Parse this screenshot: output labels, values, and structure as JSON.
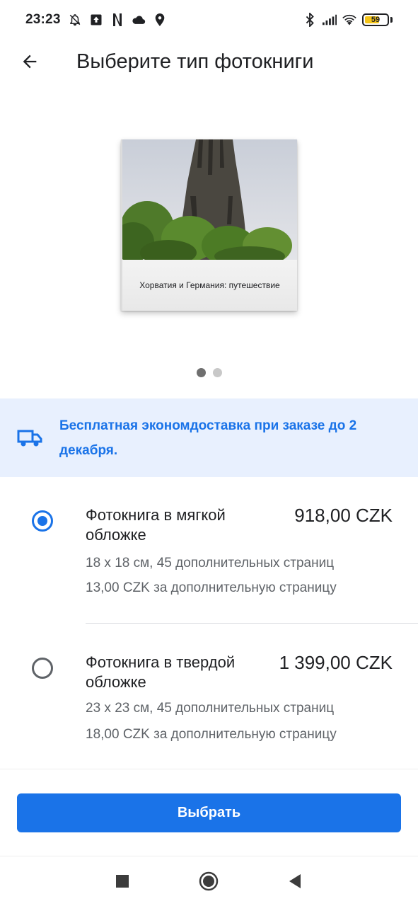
{
  "status_bar": {
    "time": "23:23",
    "battery": "59",
    "left_icons": [
      "bell-off-icon",
      "upload-icon",
      "netflix-icon",
      "cloud-icon",
      "location-icon"
    ],
    "right_icons": [
      "bluetooth-icon",
      "signal-icon",
      "wifi-icon",
      "battery-icon"
    ]
  },
  "app_bar": {
    "title": "Выберите тип фотокниги"
  },
  "book_preview": {
    "caption": "Хорватия и Германия: путешествие"
  },
  "carousel": {
    "pages": 2,
    "active_index": 0
  },
  "banner": {
    "text": "Бесплатная экономдоставка при заказе до 2 декабря."
  },
  "options": [
    {
      "name": "Фотокнига в мягкой обложке",
      "price": "918,00 CZK",
      "size": "18 x 18 см, 45 дополнительных страниц",
      "extra": "13,00 CZK за дополнительную страницу",
      "selected": true
    },
    {
      "name": "Фотокнига в твердой обложке",
      "price": "1 399,00 CZK",
      "size": "23 x 23 см, 45 дополнительных страниц",
      "extra": "18,00 CZK за дополнительную страницу",
      "selected": false
    }
  ],
  "select_button": {
    "label": "Выбрать"
  },
  "colors": {
    "accent": "#1a73e8",
    "banner_bg": "#e8f0fe",
    "battery": "#f5c518"
  }
}
